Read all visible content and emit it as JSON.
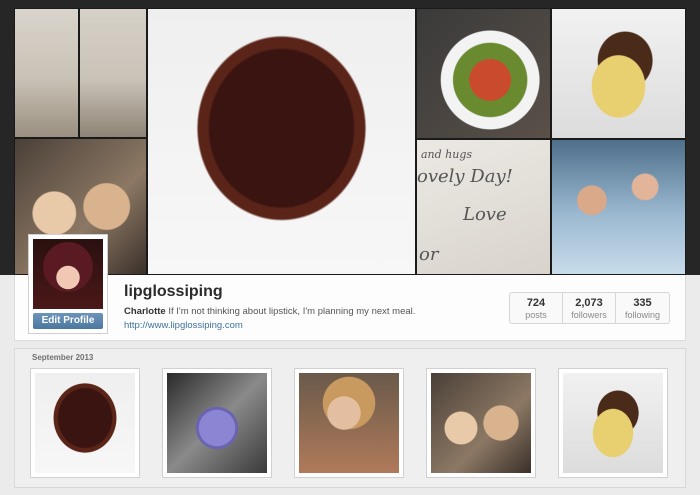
{
  "cover": {
    "photos": [
      {
        "name": "cover-photo-school-uniform-1",
        "icon": "photo-icon"
      },
      {
        "name": "cover-photo-school-uniform-2",
        "icon": "photo-icon"
      },
      {
        "name": "cover-photo-selfie",
        "icon": "photo-icon"
      },
      {
        "name": "cover-photo-cupcake",
        "icon": "photo-icon"
      },
      {
        "name": "cover-photo-salad",
        "icon": "photo-icon"
      },
      {
        "name": "cover-photo-card",
        "icon": "photo-icon"
      },
      {
        "name": "cover-photo-pasta",
        "icon": "photo-icon"
      },
      {
        "name": "cover-photo-pool",
        "icon": "photo-icon"
      }
    ],
    "card_text": [
      "and hugs",
      "ovely Day!",
      "Love",
      "or"
    ]
  },
  "profile": {
    "username": "lipglossiping",
    "display_name": "Charlotte",
    "bio": "If I'm not thinking about lipstick, I'm planning my next meal.",
    "website": "http://www.lipglossiping.com",
    "edit_button": "Edit Profile",
    "stats": [
      {
        "count": "724",
        "label": "posts"
      },
      {
        "count": "2,073",
        "label": "followers"
      },
      {
        "count": "335",
        "label": "following"
      }
    ]
  },
  "feed": {
    "month": "September 2013",
    "thumbnails": [
      "cupcake",
      "purple-macaron-tin",
      "girl-portrait",
      "selfie",
      "pasta"
    ]
  },
  "colors": {
    "link": "#3f729b",
    "button": "#4b77a0",
    "background": "#ebebeb",
    "cover": "#262626"
  }
}
